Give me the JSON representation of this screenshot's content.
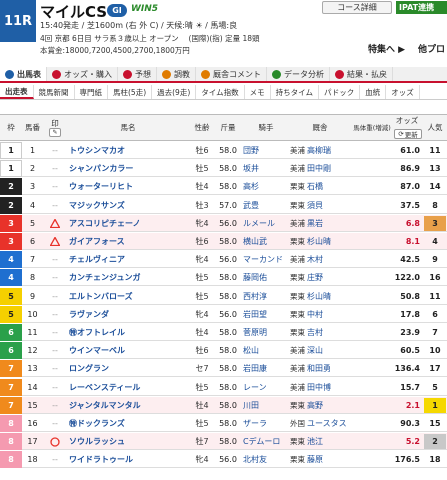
{
  "header": {
    "race_no": "11R",
    "title": "マイルCS",
    "grade": "GI",
    "win5": "WIN5",
    "course_button": "コース詳細",
    "ipat_button": "IPAT連携",
    "info1": "15:40発走 / 芝1600m (右 外 C) / 天候:晴 ☀ / 馬場:良",
    "info2": "4回 京都 6日目 サラ系３歳以上 オープン　 (国際)(指) 定量 18頭",
    "info3": "本賞金:18000,7200,4500,2700,1800万円",
    "tokusen": "特集へ ▶",
    "nextpro": "他プロ"
  },
  "tabs_main": [
    {
      "label": "出馬表",
      "color": "#1f5fa6",
      "active": true
    },
    {
      "label": "オッズ・購入",
      "color": "#c8102e",
      "active": false
    },
    {
      "label": "予想",
      "color": "#c8102e",
      "active": false
    },
    {
      "label": "調教",
      "color": "#e07b00",
      "active": false
    },
    {
      "label": "厩舎コメント",
      "color": "#e07b00",
      "active": false
    },
    {
      "label": "データ分析",
      "color": "#2a8a2a",
      "active": false
    },
    {
      "label": "結果・払戻",
      "color": "#c8102e",
      "active": false
    }
  ],
  "tabs_sub": [
    "出走表",
    "競馬新聞",
    "専門紙",
    "馬柱(5走)",
    "過去(9走)",
    "タイム指数",
    "メモ",
    "持ちタイム",
    "パドック",
    "血統",
    "オッズ"
  ],
  "table_headers": {
    "waku": "枠",
    "uma": "馬番",
    "mark": "印",
    "name": "馬名",
    "sexage": "性齢",
    "kg": "斤量",
    "jockey": "騎手",
    "trainer": "厩舎",
    "weight": "馬体重(増減)",
    "odds": "オッズ",
    "refresh": "更新",
    "pop": "人気"
  },
  "rows": [
    {
      "waku": "1",
      "uma": "1",
      "name": "トウシンマカオ",
      "sexage": "牡6",
      "kg": "58.0",
      "jockey": "団野",
      "region": "美浦",
      "trainer": "高柳瑞",
      "odds": "61.0",
      "pop": "11",
      "pink": false,
      "mark": ""
    },
    {
      "waku": "1",
      "uma": "2",
      "name": "シャンパンカラー",
      "sexage": "牡5",
      "kg": "58.0",
      "jockey": "坂井",
      "region": "美浦",
      "trainer": "田中剛",
      "odds": "86.9",
      "pop": "13",
      "pink": false,
      "mark": ""
    },
    {
      "waku": "2",
      "uma": "3",
      "name": "ウォーターリヒト",
      "sexage": "牡4",
      "kg": "58.0",
      "jockey": "高杉",
      "region": "栗東",
      "trainer": "石橋",
      "odds": "87.0",
      "pop": "14",
      "pink": false,
      "mark": ""
    },
    {
      "waku": "2",
      "uma": "4",
      "name": "マジックサンズ",
      "sexage": "牡3",
      "kg": "57.0",
      "jockey": "武豊",
      "region": "栗東",
      "trainer": "須貝",
      "odds": "37.5",
      "pop": "8",
      "pink": false,
      "mark": ""
    },
    {
      "waku": "3",
      "uma": "5",
      "name": "アスコリピチェーノ",
      "sexage": "牝4",
      "kg": "56.0",
      "jockey": "ルメール",
      "region": "美浦",
      "trainer": "黒岩",
      "odds": "6.8",
      "pop": "3",
      "pink": true,
      "mark": "triangle"
    },
    {
      "waku": "3",
      "uma": "6",
      "name": "ガイアフォース",
      "sexage": "牡6",
      "kg": "58.0",
      "jockey": "横山武",
      "region": "栗東",
      "trainer": "杉山晴",
      "odds": "8.1",
      "pop": "4",
      "pink": true,
      "mark": "triangle"
    },
    {
      "waku": "4",
      "uma": "7",
      "name": "チェルヴィニア",
      "sexage": "牝4",
      "kg": "56.0",
      "jockey": "マーカンド",
      "region": "美浦",
      "trainer": "木村",
      "odds": "42.5",
      "pop": "9",
      "pink": false,
      "mark": ""
    },
    {
      "waku": "4",
      "uma": "8",
      "name": "カンチェンジュンガ",
      "sexage": "牡5",
      "kg": "58.0",
      "jockey": "藤岡佑",
      "region": "栗東",
      "trainer": "庄野",
      "odds": "122.0",
      "pop": "16",
      "pink": false,
      "mark": ""
    },
    {
      "waku": "5",
      "uma": "9",
      "name": "エルトンバローズ",
      "sexage": "牡5",
      "kg": "58.0",
      "jockey": "西村淳",
      "region": "栗東",
      "trainer": "杉山晴",
      "odds": "50.8",
      "pop": "11",
      "pink": false,
      "mark": ""
    },
    {
      "waku": "5",
      "uma": "10",
      "name": "ラヴァンダ",
      "sexage": "牝4",
      "kg": "56.0",
      "jockey": "岩田望",
      "region": "栗東",
      "trainer": "中村",
      "odds": "17.8",
      "pop": "6",
      "pink": false,
      "mark": ""
    },
    {
      "waku": "6",
      "uma": "11",
      "name": "㊕オフトレイル",
      "sexage": "牡4",
      "kg": "58.0",
      "jockey": "菅原明",
      "region": "栗東",
      "trainer": "吉村",
      "odds": "23.9",
      "pop": "7",
      "pink": false,
      "mark": ""
    },
    {
      "waku": "6",
      "uma": "12",
      "name": "ウインマーベル",
      "sexage": "牡6",
      "kg": "58.0",
      "jockey": "松山",
      "region": "美浦",
      "trainer": "深山",
      "odds": "60.5",
      "pop": "10",
      "pink": false,
      "mark": ""
    },
    {
      "waku": "7",
      "uma": "13",
      "name": "ロングラン",
      "sexage": "セ7",
      "kg": "58.0",
      "jockey": "岩田康",
      "region": "美浦",
      "trainer": "和田勇",
      "odds": "136.4",
      "pop": "17",
      "pink": false,
      "mark": ""
    },
    {
      "waku": "7",
      "uma": "14",
      "name": "レーベンスティール",
      "sexage": "牡5",
      "kg": "58.0",
      "jockey": "レーン",
      "region": "美浦",
      "trainer": "田中博",
      "odds": "15.7",
      "pop": "5",
      "pink": false,
      "mark": ""
    },
    {
      "waku": "7",
      "uma": "15",
      "name": "ジャンタルマンタル",
      "sexage": "牡4",
      "kg": "58.0",
      "jockey": "川田",
      "region": "栗東",
      "trainer": "高野",
      "odds": "2.1",
      "pop": "1",
      "pink": true,
      "mark": ""
    },
    {
      "waku": "8",
      "uma": "16",
      "name": "㊕ドックランズ",
      "sexage": "牡5",
      "kg": "58.0",
      "jockey": "ザーラ",
      "region": "外国",
      "trainer": "ユースタス",
      "odds": "90.3",
      "pop": "15",
      "pink": false,
      "mark": ""
    },
    {
      "waku": "8",
      "uma": "17",
      "name": "ソウルラッシュ",
      "sexage": "牡7",
      "kg": "58.0",
      "jockey": "Cデムーロ",
      "region": "栗東",
      "trainer": "池江",
      "odds": "5.2",
      "pop": "2",
      "pink": true,
      "mark": "circle"
    },
    {
      "waku": "8",
      "uma": "18",
      "name": "ワイドラトゥール",
      "sexage": "牝4",
      "kg": "56.0",
      "jockey": "北村友",
      "region": "栗東",
      "trainer": "藤原",
      "odds": "176.5",
      "pop": "18",
      "pink": false,
      "mark": ""
    }
  ],
  "waku_colors": {
    "1": {
      "bg": "#ffffff",
      "fg": "#222222"
    },
    "2": {
      "bg": "#222222",
      "fg": "#ffffff"
    },
    "3": {
      "bg": "#e8322a",
      "fg": "#ffffff"
    },
    "4": {
      "bg": "#1f6fd0",
      "fg": "#ffffff"
    },
    "5": {
      "bg": "#f5d000",
      "fg": "#222222"
    },
    "6": {
      "bg": "#2aa04a",
      "fg": "#ffffff"
    },
    "7": {
      "bg": "#f08a1c",
      "fg": "#ffffff"
    },
    "8": {
      "bg": "#f59ab0",
      "fg": "#ffffff"
    }
  },
  "pop_colors": {
    "1": "#f5d800",
    "2": "#c8c8c8",
    "3": "#e8a04a"
  },
  "low_odds_color": "#c8102e"
}
